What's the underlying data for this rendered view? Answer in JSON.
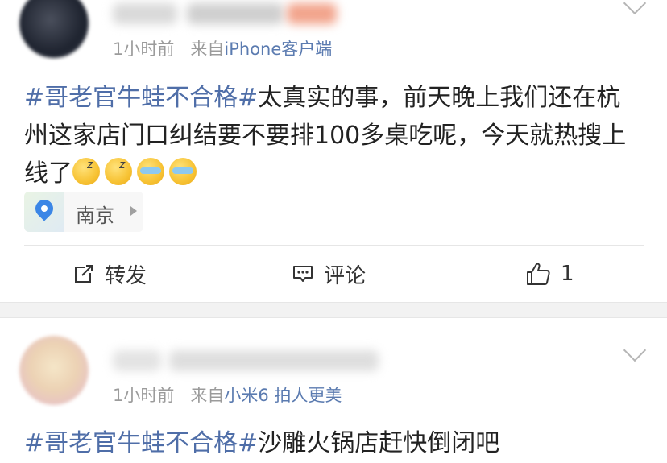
{
  "posts": [
    {
      "time": "1小时前",
      "from_prefix": "来自",
      "source": "iPhone客户端",
      "hashtag": "#哥老官牛蛙不合格#",
      "text": "太真实的事，前天晚上我们还在杭州这家店门口纠结要不要排100多桌吃呢，今天就热搜上线了",
      "location": "南京",
      "actions": {
        "repost": "转发",
        "comment": "评论",
        "like_count": "1"
      }
    },
    {
      "time": "1小时前",
      "from_prefix": "来自",
      "source": "小米6 拍人更美",
      "hashtag": "#哥老官牛蛙不合格#",
      "text": "沙雕火锅店赶快倒闭吧"
    }
  ],
  "icons": {
    "repost": "repost-icon",
    "comment": "comment-icon",
    "like": "thumbs-up-icon",
    "location": "location-pin-icon",
    "menu": "chevron-down-icon"
  },
  "colors": {
    "link": "#4f6ea8",
    "source": "#5b7bb0",
    "meta": "#9b9b9b"
  }
}
